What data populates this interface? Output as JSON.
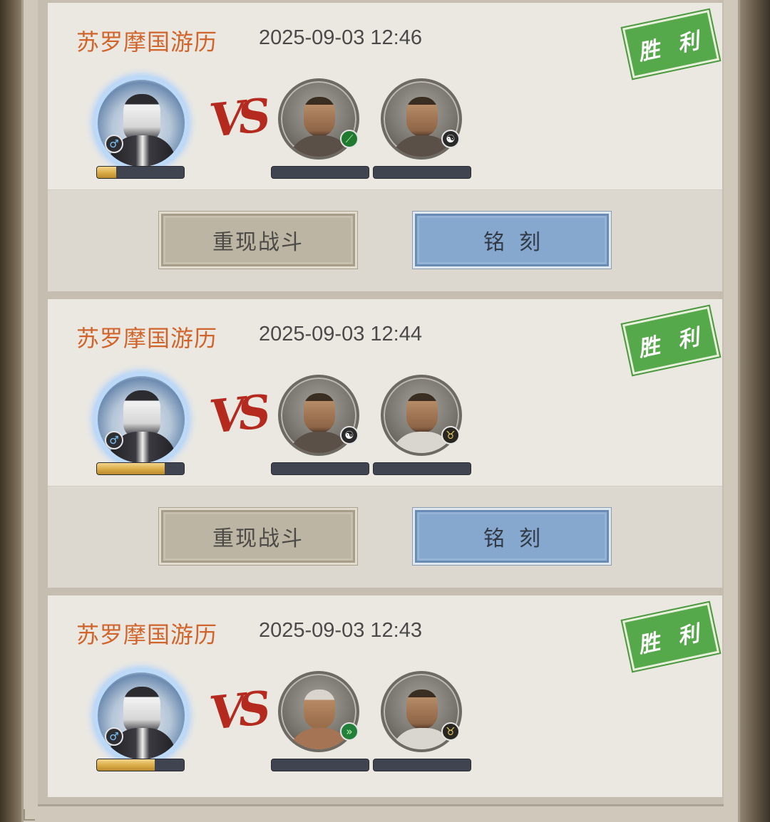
{
  "records": [
    {
      "title": "苏罗摩国游历",
      "time": "2025-09-03 12:46",
      "result": "胜 利",
      "player": {
        "badge": "♂",
        "progress": 0.22
      },
      "enemies": [
        {
          "portrait": "long-hair-swordsman",
          "badge_icon": "green-blade-icon",
          "badge": "⟋"
        },
        {
          "portrait": "bearded-man",
          "badge_icon": "yin-yang-icon",
          "badge": "☯"
        }
      ],
      "vs_label": "VS",
      "buttons": {
        "replay": "重现战斗",
        "engrave": "铭刻"
      }
    },
    {
      "title": "苏罗摩国游历",
      "time": "2025-09-03 12:44",
      "result": "胜 利",
      "player": {
        "badge": "♂",
        "progress": 0.78
      },
      "enemies": [
        {
          "portrait": "bearded-man",
          "badge_icon": "yin-yang-icon",
          "badge": "☯"
        },
        {
          "portrait": "light-robe-man",
          "badge_icon": "ox-icon",
          "badge": "♉"
        }
      ],
      "vs_label": "VS",
      "buttons": {
        "replay": "重现战斗",
        "engrave": "铭刻"
      }
    },
    {
      "title": "苏罗摩国游历",
      "time": "2025-09-03 12:43",
      "result": "胜 利",
      "player": {
        "badge": "♂",
        "progress": 0.66
      },
      "enemies": [
        {
          "portrait": "turban-man",
          "badge_icon": "green-dash-icon",
          "badge": "»"
        },
        {
          "portrait": "light-robe-man",
          "badge_icon": "ox-icon",
          "badge": "♉"
        }
      ],
      "vs_label": "VS"
    }
  ],
  "colors": {
    "title": "#d0642a",
    "stamp_green": "#56a94a",
    "replay_button": "#bdb5a3",
    "engrave_button": "#86a8cf",
    "progress_gold": "#d9ab45",
    "bar_bg": "#404451"
  }
}
